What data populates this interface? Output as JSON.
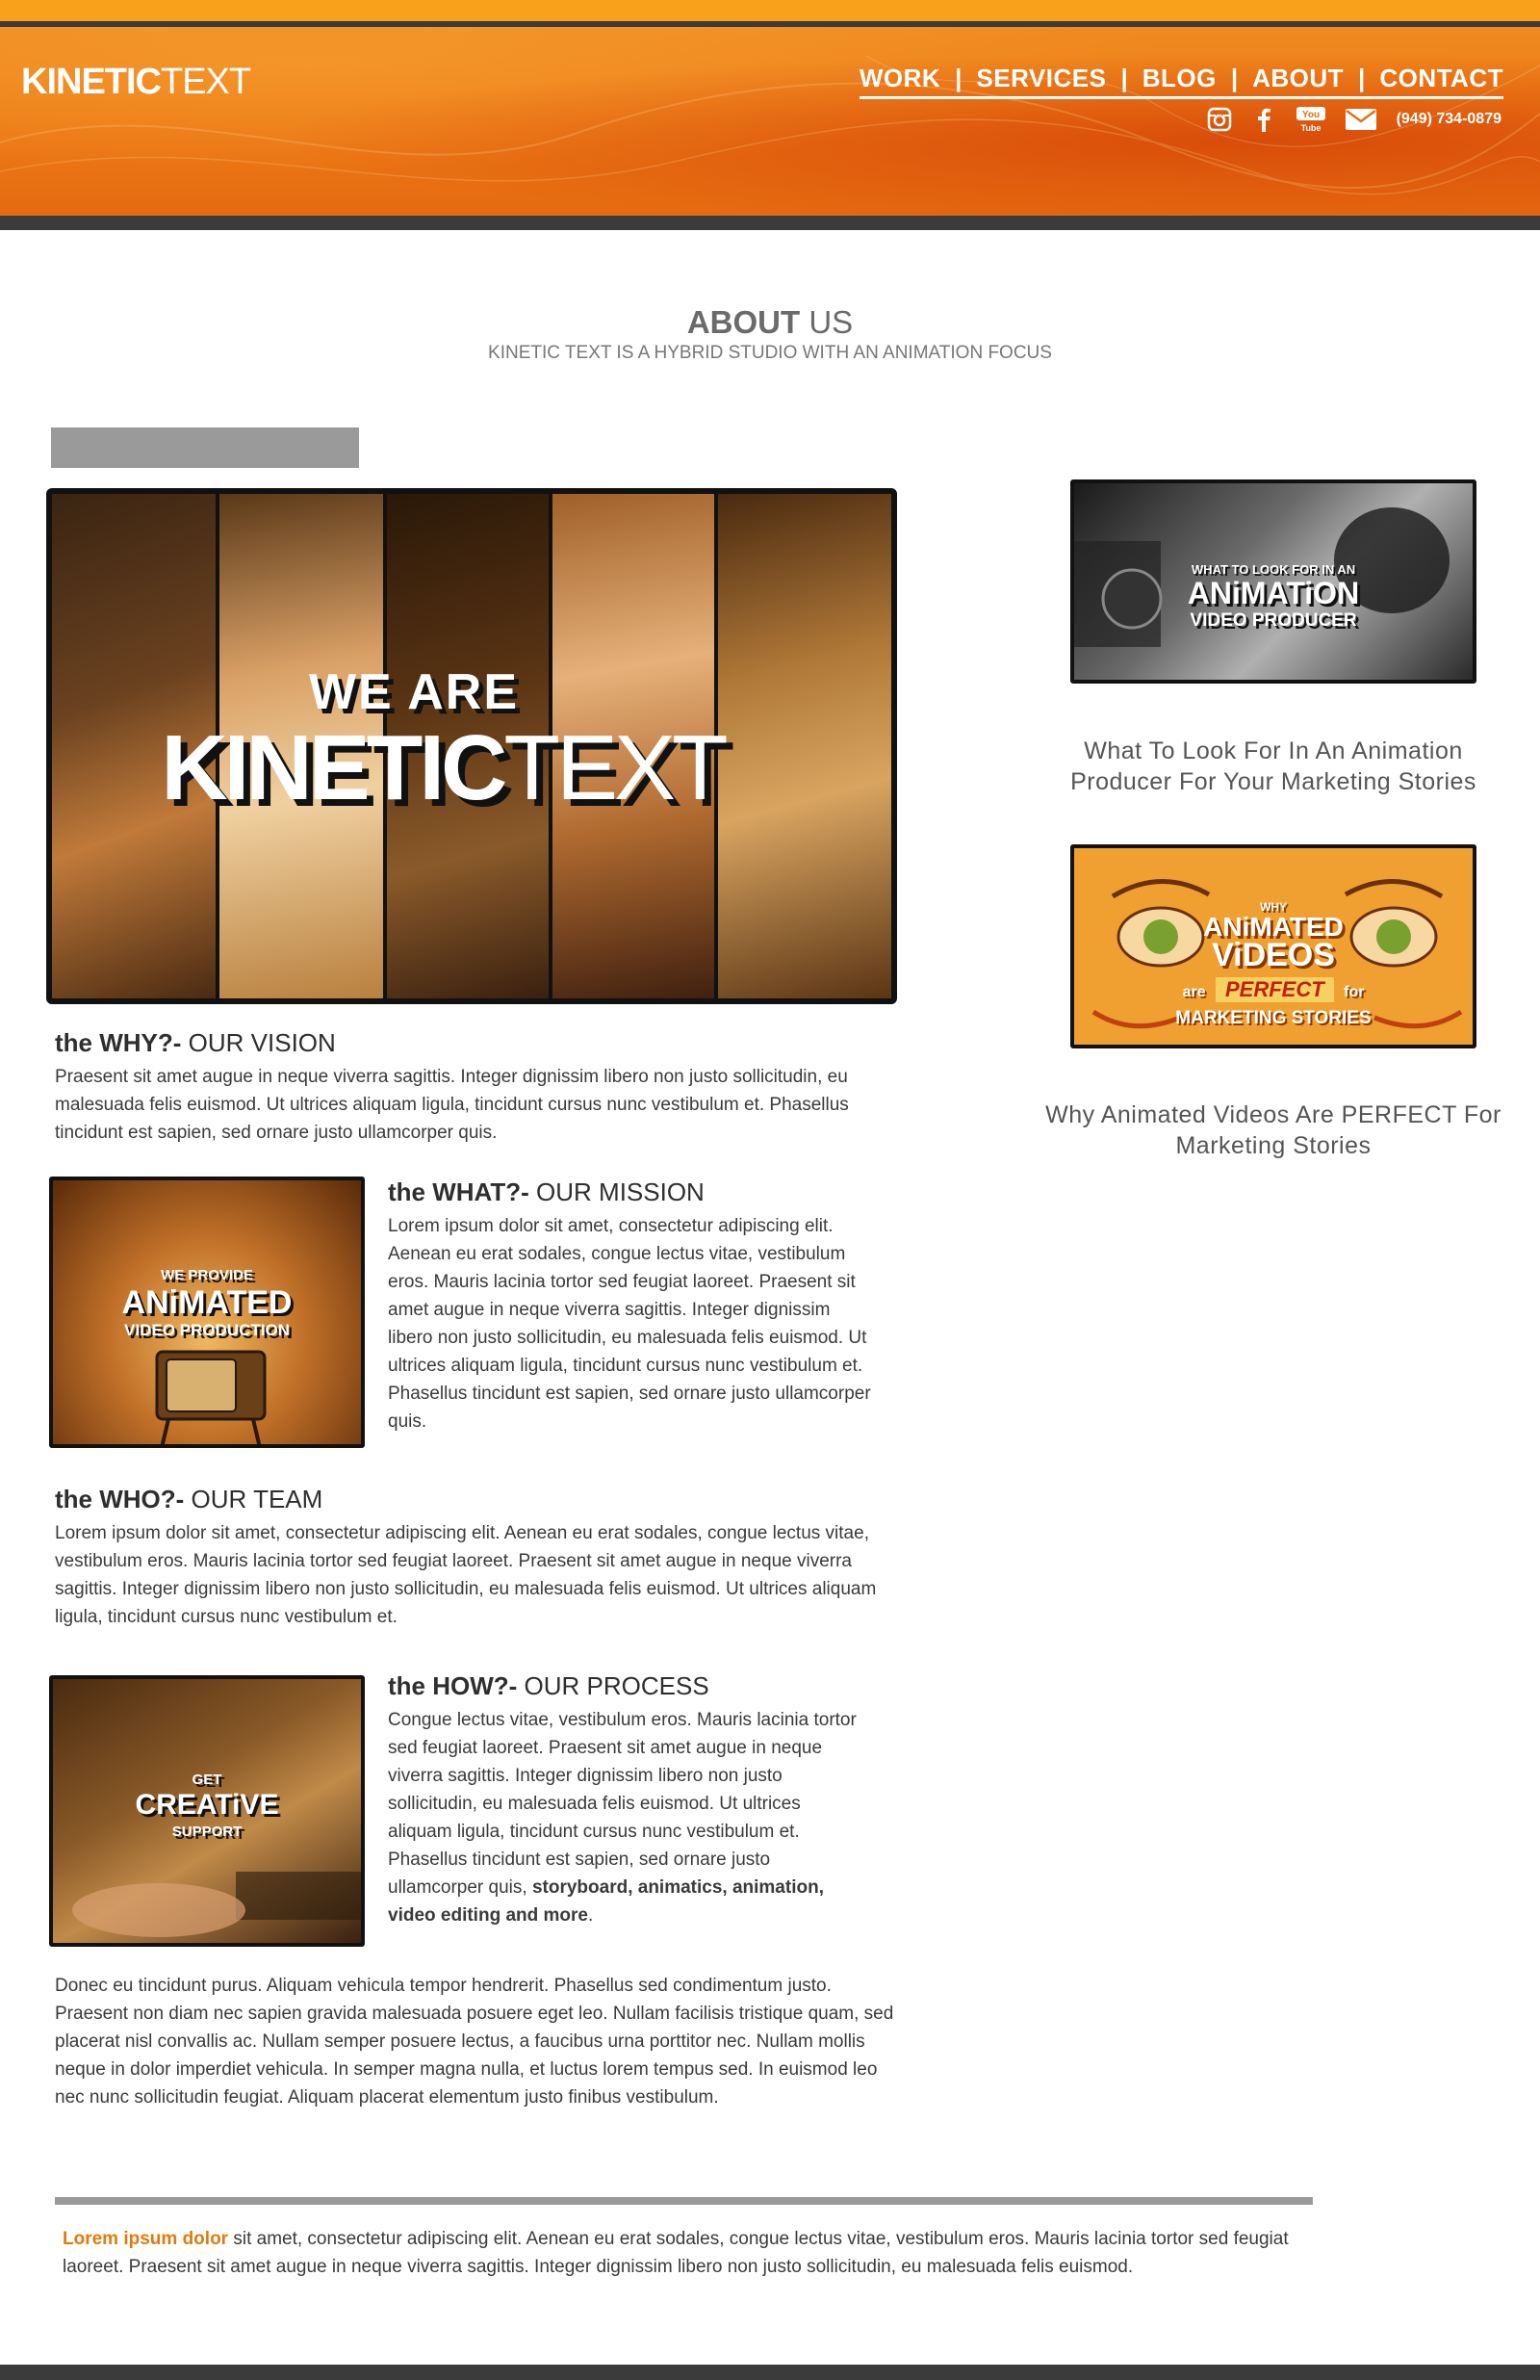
{
  "header": {
    "logo_bold": "KINETIC",
    "logo_light": "TEXT",
    "nav": [
      "WORK",
      "SERVICES",
      "BLOG",
      "ABOUT",
      "CONTACT"
    ],
    "nav_separator": "|",
    "social_icons": [
      "instagram-icon",
      "facebook-icon",
      "youtube-icon",
      "email-icon"
    ],
    "youtube_text": "You Tube",
    "phone": "(949) 734-0879"
  },
  "about": {
    "title_bold": "ABOUT",
    "title_light": "US",
    "subtitle": "KINETIC TEXT IS A HYBRID STUDIO WITH AN ANIMATION FOCUS"
  },
  "hero": {
    "line1": "WE ARE",
    "line2_bold": "KINETIC",
    "line2_light": "TEXT"
  },
  "sections": {
    "why": {
      "heading_bold": "the WHY?-",
      "heading_light": "OUR VISION",
      "body": "Praesent sit amet augue in neque viverra sagittis. Integer dignissim libero non justo sollicitudin, eu malesuada felis euismod. Ut ultrices aliquam ligula, tincidunt cursus nunc vestibulum et. Phasellus tincidunt est sapien, sed ornare justo ullamcorper quis."
    },
    "what": {
      "heading_bold": "the WHAT?-",
      "heading_light": "OUR MISSION",
      "body": "Lorem ipsum dolor sit amet, consectetur adipiscing elit. Aenean eu erat sodales, congue lectus vitae, vestibulum eros. Mauris lacinia tortor sed feugiat laoreet. Praesent sit amet augue in neque viverra sagittis. Integer dignissim libero non justo sollicitudin, eu malesuada felis euismod. Ut ultrices aliquam ligula, tincidunt cursus nunc vestibulum et. Phasellus tincidunt est sapien, sed ornare justo ullamcorper quis.",
      "thumb_top": "WE PROVIDE",
      "thumb_main": "ANiMATED",
      "thumb_bottom": "VIDEO PRODUCTION"
    },
    "who": {
      "heading_bold": "the WHO?-",
      "heading_light": "OUR TEAM",
      "body": "Lorem ipsum dolor sit amet, consectetur adipiscing elit. Aenean eu erat sodales, congue lectus vitae, vestibulum eros. Mauris lacinia tortor sed feugiat laoreet. Praesent sit amet augue in neque viverra sagittis. Integer dignissim libero non justo sollicitudin, eu malesuada felis euismod. Ut ultrices aliquam ligula, tincidunt cursus nunc vestibulum et."
    },
    "how": {
      "heading_bold": "the HOW?-",
      "heading_light": "OUR PROCESS",
      "body": "Congue lectus vitae, vestibulum eros. Mauris lacinia tortor sed feugiat laoreet. Praesent sit amet augue in neque viverra sagittis. Integer dignissim libero non justo sollicitudin, eu malesuada felis euismod. Ut ultrices aliquam ligula, tincidunt cursus nunc vestibulum et. Phasellus tincidunt est sapien, sed ornare justo ullamcorper quis,",
      "body_bold": "storyboard, animatics, animation, video editing and more",
      "body_end": ".",
      "thumb_top": "GET",
      "thumb_main": "CREATiVE",
      "thumb_bottom": "SUPPORT"
    },
    "closing": "Donec eu tincidunt purus. Aliquam vehicula tempor hendrerit. Phasellus sed condimentum justo. Praesent non diam nec sapien gravida malesuada posuere eget leo. Nullam facilisis tristique quam, sed placerat nisl convallis ac. Nullam semper posuere lectus, a faucibus urna porttitor nec. Nullam mollis neque in dolor imperdiet vehicula. In semper magna nulla, et luctus lorem tempus sed. In euismod leo nec nunc sollicitudin feugiat. Aliquam placerat elementum justo finibus vestibulum."
  },
  "sidebar": {
    "post1": {
      "thumb_top": "WHAT TO LOOK FOR IN AN",
      "thumb_main": "ANiMATiON",
      "thumb_bottom": "VIDEO PRODUCER",
      "caption": "What To Look For In An Animation Producer For Your Marketing Stories"
    },
    "post2": {
      "thumb_top": "WHY",
      "thumb_main1": "ANiMATED",
      "thumb_main2": "ViDEOS",
      "thumb_are": "are",
      "thumb_perfect": "PERFECT",
      "thumb_for": "for",
      "thumb_bottom": "MARKETING STORIES",
      "caption": "Why Animated Videos Are PERFECT For Marketing Stories"
    }
  },
  "footer_note": {
    "highlight": "Lorem ipsum dolor",
    "text": " sit amet, consectetur adipiscing elit. Aenean eu erat sodales, congue lectus vitae, vestibulum eros. Mauris lacinia tortor sed feugiat laoreet. Praesent sit amet augue in neque viverra sagittis. Integer dignissim libero non justo sollicitudin, eu malesuada felis euismod."
  },
  "colors": {
    "accent_orange": "#f9a11b",
    "header_orange": "#ee7d17",
    "dark_bar": "#3b3b3b",
    "highlight_text": "#e07b0d"
  }
}
